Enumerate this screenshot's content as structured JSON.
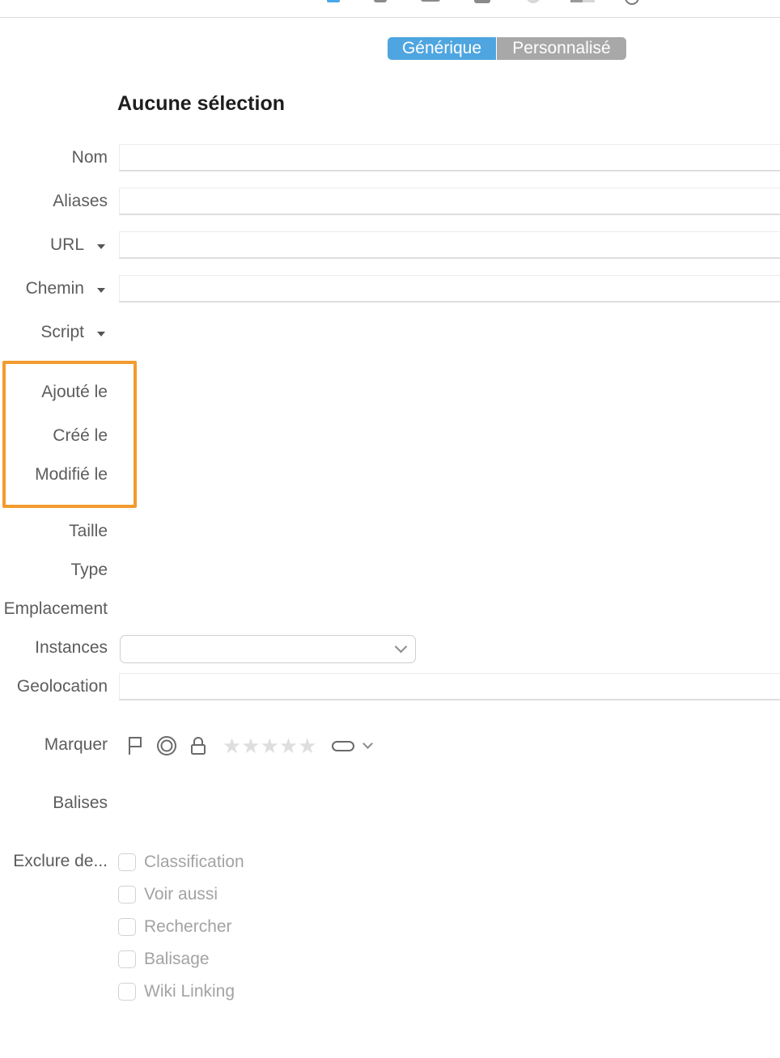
{
  "segmented": {
    "generic": "Générique",
    "custom": "Personnalisé",
    "selected": "Générique"
  },
  "title": "Aucune sélection",
  "labels": {
    "name": "Nom",
    "aliases": "Aliases",
    "url": "URL",
    "path": "Chemin",
    "script": "Script",
    "added": "Ajouté le",
    "created": "Créé le",
    "modified": "Modifié le",
    "size": "Taille",
    "type": "Type",
    "location": "Emplacement",
    "instances": "Instances",
    "geolocation": "Geolocation",
    "mark": "Marquer",
    "tags": "Balises",
    "exclude": "Exclure de..."
  },
  "fields": {
    "name": "",
    "aliases": "",
    "url": "",
    "path": "",
    "geolocation": "",
    "instances_selected": ""
  },
  "mark": {
    "icons": [
      "flag-icon",
      "unread-circle-icon",
      "lock-icon",
      "rating-stars",
      "label-pill-icon",
      "chevron-down-icon"
    ],
    "stars": "★★★★★",
    "rating": 0
  },
  "exclude_options": [
    {
      "label": "Classification",
      "checked": false
    },
    {
      "label": "Voir aussi",
      "checked": false
    },
    {
      "label": "Rechercher",
      "checked": false
    },
    {
      "label": "Balisage",
      "checked": false
    },
    {
      "label": "Wiki Linking",
      "checked": false
    }
  ],
  "colors": {
    "accent": "#4ea5e0",
    "highlight": "#f29b2e"
  }
}
